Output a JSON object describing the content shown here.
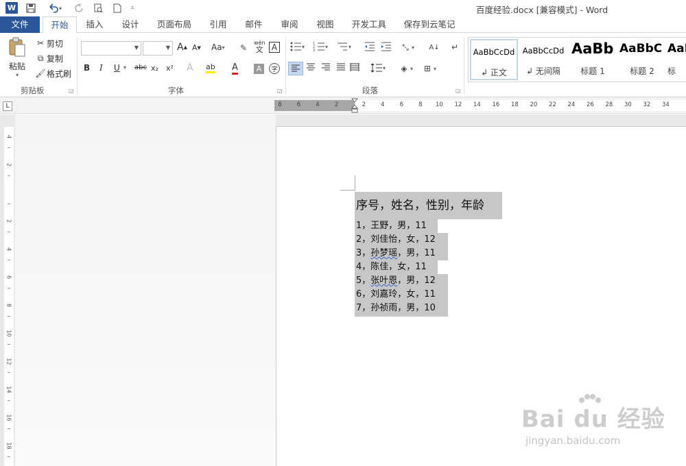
{
  "window": {
    "title": "百度经验.docx [兼容模式] - Word"
  },
  "quick_access": {
    "word_logo": "W",
    "save_icon": "save-icon",
    "undo_icon": "undo-icon",
    "redo_icon": "redo-icon"
  },
  "tabs": [
    {
      "label": "文件"
    },
    {
      "label": "开始"
    },
    {
      "label": "插入"
    },
    {
      "label": "设计"
    },
    {
      "label": "页面布局"
    },
    {
      "label": "引用"
    },
    {
      "label": "邮件"
    },
    {
      "label": "审阅"
    },
    {
      "label": "视图"
    },
    {
      "label": "开发工具"
    },
    {
      "label": "保存到云笔记"
    }
  ],
  "clipboard": {
    "paste": "粘贴",
    "cut": "剪切",
    "copy": "复制",
    "format_painter": "格式刷",
    "group": "剪贴板"
  },
  "font": {
    "group": "字体",
    "font_name": "",
    "font_size": "",
    "grow": "A",
    "shrink": "A",
    "case": "Aa",
    "phonetic": "wén",
    "phonetic_sub": "文",
    "border_char": "A",
    "bold": "B",
    "italic": "I",
    "underline": "U",
    "strike": "abc",
    "sub": "x₂",
    "sup": "x²",
    "effects": "A",
    "highlight": "ab",
    "font_color": "A",
    "shading": "A",
    "enclose": "字"
  },
  "paragraph": {
    "group": "段落"
  },
  "styles": [
    {
      "sample": "AaBbCcDd",
      "name": "↲ 正文"
    },
    {
      "sample": "AaBbCcDd",
      "name": "↲ 无间隔"
    },
    {
      "sample": "AaBb",
      "name": "标题 1"
    },
    {
      "sample": "AaBbC",
      "name": "标题 2"
    },
    {
      "sample": "AaI",
      "name": "标"
    }
  ],
  "ruler": {
    "tab_selector": "L",
    "h_numbers": [
      "8",
      "6",
      "4",
      "2",
      "2",
      "4",
      "6",
      "8",
      "10",
      "12",
      "14",
      "16",
      "18",
      "20",
      "22",
      "24",
      "26",
      "28",
      "30",
      "32",
      "34"
    ],
    "v_numbers": [
      "4",
      "2",
      "",
      "2",
      "4",
      "6",
      "8",
      "10",
      "12",
      "14",
      "16",
      "18"
    ]
  },
  "document": {
    "heading": "序号，姓名，性别，年龄",
    "rows": [
      {
        "num": "1，",
        "name": "王野",
        "rest": "，男，11"
      },
      {
        "num": "2，",
        "name": "刘佳怡",
        "rest": "，女，12"
      },
      {
        "num": "3，",
        "name": "孙梦瑶",
        "rest": "，男，11"
      },
      {
        "num": "4，",
        "name": "陈佳",
        "rest": "，女，11"
      },
      {
        "num": "5，",
        "name": "张叶恩",
        "rest": "，男，12"
      },
      {
        "num": "6，",
        "name": "刘嘉玲",
        "rest": "，女，11"
      },
      {
        "num": "7，",
        "name": "孙祯雨",
        "rest": "，男，10"
      }
    ]
  },
  "watermark": {
    "brand": "Bai du 经验",
    "url": "jingyan.baidu.com"
  }
}
